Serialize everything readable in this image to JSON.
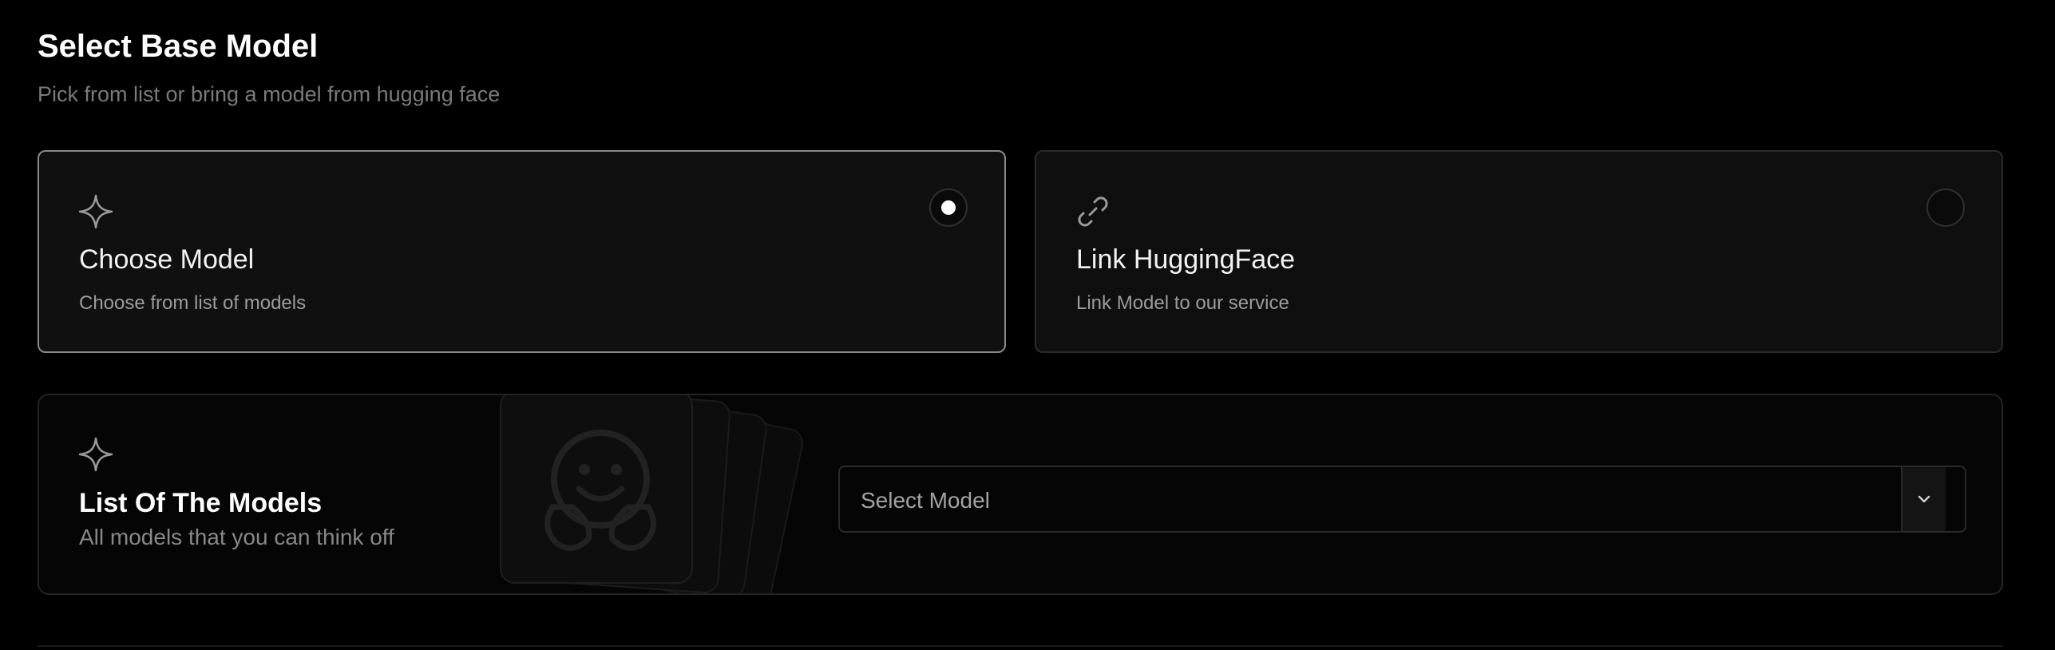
{
  "header": {
    "title": "Select Base Model",
    "subtitle": "Pick from list or bring a model from hugging face"
  },
  "options": [
    {
      "title": "Choose Model",
      "description": "Choose from list of models",
      "icon": "sparkle-icon",
      "selected": true
    },
    {
      "title": "Link HuggingFace",
      "description": "Link Model to our service",
      "icon": "link-icon",
      "selected": false
    }
  ],
  "models_panel": {
    "title": "List Of The Models",
    "description": "All models that you can think off",
    "icon": "sparkle-icon",
    "watermark_icon": "hugging-face-logo",
    "select": {
      "placeholder": "Select Model",
      "toggle_icon": "chevron-down-icon"
    }
  },
  "colors": {
    "background": "#000000",
    "card_background": "#0f0f0f",
    "selected_border": "#8a8a8a",
    "muted_text": "#9c9c9c"
  }
}
